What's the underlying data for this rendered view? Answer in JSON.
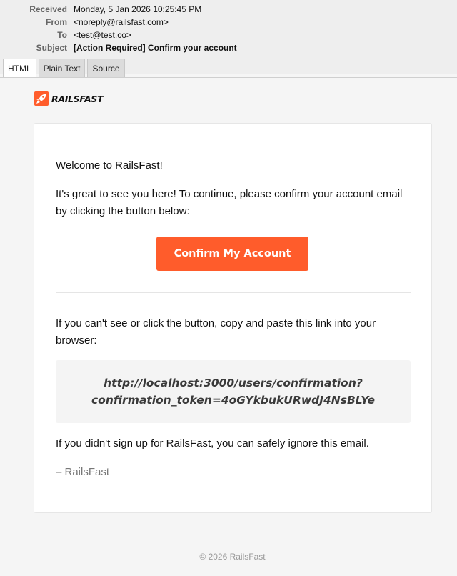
{
  "header": {
    "received_label": "Received",
    "received_value": "Monday, 5 Jan 2026 10:25:45 PM",
    "from_label": "From",
    "from_value": "<noreply@railsfast.com>",
    "to_label": "To",
    "to_value": "<test@test.co>",
    "subject_label": "Subject",
    "subject_value": "[Action Required] Confirm your account"
  },
  "tabs": [
    {
      "label": "HTML",
      "active": true
    },
    {
      "label": "Plain Text",
      "active": false
    },
    {
      "label": "Source",
      "active": false
    }
  ],
  "email": {
    "brand": "RAILSFAST",
    "brand_color": "#ff5c2b",
    "greeting": "Welcome to RailsFast!",
    "intro": "It's great to see you here! To continue, please confirm your account email by clicking the button below:",
    "button_label": "Confirm My Account",
    "fallback_text": "If you can't see or click the button, copy and paste this link into your browser:",
    "link_line1": "http://localhost:3000/users/confirmation?",
    "link_line2": "confirmation_token=4oGYkbukURwdJ4NsBLYe",
    "ignore_text": "If you didn't sign up for RailsFast, you can safely ignore this email.",
    "signoff": "– RailsFast",
    "footer": "© 2026 RailsFast"
  }
}
